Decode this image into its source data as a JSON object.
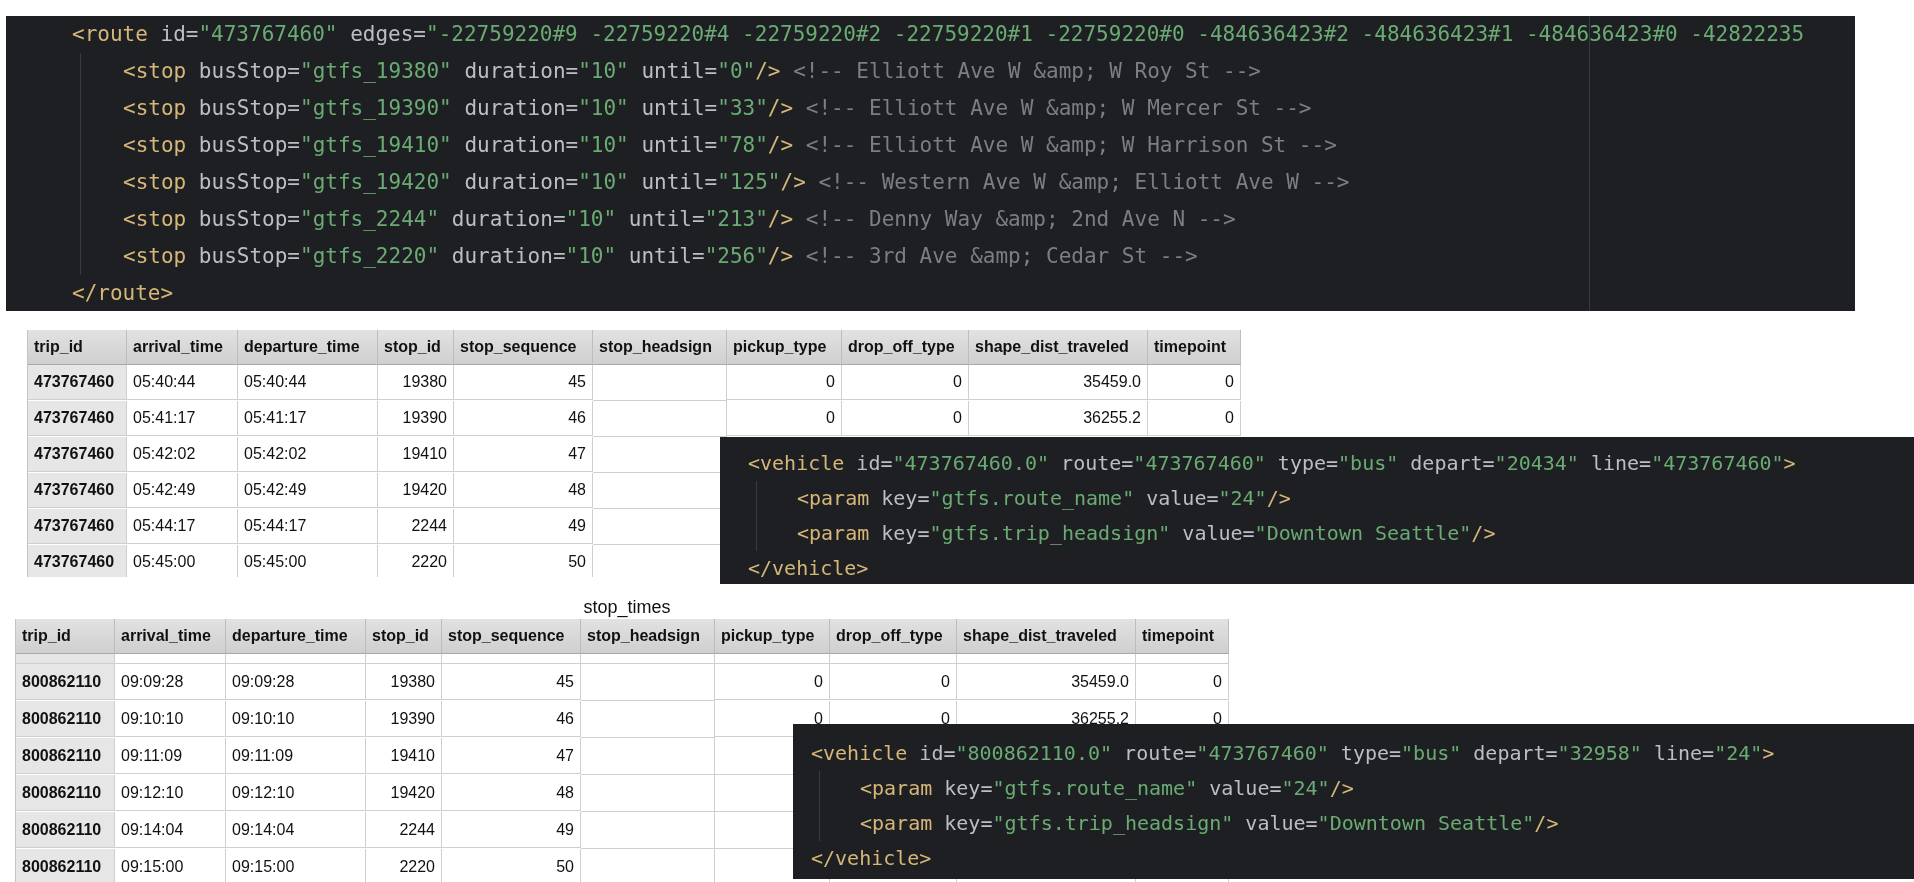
{
  "route_code": {
    "open": [
      {
        "kind": "tag",
        "text": "<route"
      },
      {
        "kind": "attr",
        "text": " id="
      },
      {
        "kind": "value",
        "text": "\"473767460\""
      },
      {
        "kind": "attr",
        "text": " edges="
      },
      {
        "kind": "value",
        "text": "\"-22759220#9 -22759220#4 -22759220#2 -22759220#1 -22759220#0 -484636423#2 -484636423#1 -484636423#0 -42822235"
      }
    ],
    "children": [
      {
        "tokens": [
          {
            "kind": "tag",
            "text": "<stop"
          },
          {
            "kind": "attr",
            "text": " busStop="
          },
          {
            "kind": "value",
            "text": "\"gtfs_19380\""
          },
          {
            "kind": "attr",
            "text": " duration="
          },
          {
            "kind": "value",
            "text": "\"10\""
          },
          {
            "kind": "attr",
            "text": " until="
          },
          {
            "kind": "value",
            "text": "\"0\""
          },
          {
            "kind": "tag",
            "text": "/>"
          },
          {
            "kind": "comment",
            "text": " <!-- Elliott Ave W &amp; W Roy St -->"
          }
        ]
      },
      {
        "tokens": [
          {
            "kind": "tag",
            "text": "<stop"
          },
          {
            "kind": "attr",
            "text": " busStop="
          },
          {
            "kind": "value",
            "text": "\"gtfs_19390\""
          },
          {
            "kind": "attr",
            "text": " duration="
          },
          {
            "kind": "value",
            "text": "\"10\""
          },
          {
            "kind": "attr",
            "text": " until="
          },
          {
            "kind": "value",
            "text": "\"33\""
          },
          {
            "kind": "tag",
            "text": "/>"
          },
          {
            "kind": "comment",
            "text": " <!-- Elliott Ave W &amp; W Mercer St -->"
          }
        ]
      },
      {
        "tokens": [
          {
            "kind": "tag",
            "text": "<stop"
          },
          {
            "kind": "attr",
            "text": " busStop="
          },
          {
            "kind": "value",
            "text": "\"gtfs_19410\""
          },
          {
            "kind": "attr",
            "text": " duration="
          },
          {
            "kind": "value",
            "text": "\"10\""
          },
          {
            "kind": "attr",
            "text": " until="
          },
          {
            "kind": "value",
            "text": "\"78\""
          },
          {
            "kind": "tag",
            "text": "/>"
          },
          {
            "kind": "comment",
            "text": " <!-- Elliott Ave W &amp; W Harrison St -->"
          }
        ]
      },
      {
        "tokens": [
          {
            "kind": "tag",
            "text": "<stop"
          },
          {
            "kind": "attr",
            "text": " busStop="
          },
          {
            "kind": "value",
            "text": "\"gtfs_19420\""
          },
          {
            "kind": "attr",
            "text": " duration="
          },
          {
            "kind": "value",
            "text": "\"10\""
          },
          {
            "kind": "attr",
            "text": " until="
          },
          {
            "kind": "value",
            "text": "\"125\""
          },
          {
            "kind": "tag",
            "text": "/>"
          },
          {
            "kind": "comment",
            "text": " <!-- Western Ave W &amp; Elliott Ave W -->"
          }
        ]
      },
      {
        "tokens": [
          {
            "kind": "tag",
            "text": "<stop"
          },
          {
            "kind": "attr",
            "text": " busStop="
          },
          {
            "kind": "value",
            "text": "\"gtfs_2244\""
          },
          {
            "kind": "attr",
            "text": " duration="
          },
          {
            "kind": "value",
            "text": "\"10\""
          },
          {
            "kind": "attr",
            "text": " until="
          },
          {
            "kind": "value",
            "text": "\"213\""
          },
          {
            "kind": "tag",
            "text": "/>"
          },
          {
            "kind": "comment",
            "text": " <!-- Denny Way &amp; 2nd Ave N -->"
          }
        ]
      },
      {
        "tokens": [
          {
            "kind": "tag",
            "text": "<stop"
          },
          {
            "kind": "attr",
            "text": " busStop="
          },
          {
            "kind": "value",
            "text": "\"gtfs_2220\""
          },
          {
            "kind": "attr",
            "text": " duration="
          },
          {
            "kind": "value",
            "text": "\"10\""
          },
          {
            "kind": "attr",
            "text": " until="
          },
          {
            "kind": "value",
            "text": "\"256\""
          },
          {
            "kind": "tag",
            "text": "/>"
          },
          {
            "kind": "comment",
            "text": " <!-- 3rd Ave &amp; Cedar St -->"
          }
        ]
      }
    ],
    "close": [
      {
        "kind": "tag",
        "text": "</route>"
      }
    ]
  },
  "stop_times_top": {
    "columns": [
      "trip_id",
      "arrival_time",
      "departure_time",
      "stop_id",
      "stop_sequence",
      "stop_headsign",
      "pickup_type",
      "drop_off_type",
      "shape_dist_traveled",
      "timepoint"
    ],
    "rows": [
      [
        "473767460",
        "05:40:44",
        "05:40:44",
        "19380",
        "45",
        null,
        "0",
        "0",
        "35459.0",
        "0"
      ],
      [
        "473767460",
        "05:41:17",
        "05:41:17",
        "19390",
        "46",
        null,
        "0",
        "0",
        "36255.2",
        "0"
      ],
      [
        "473767460",
        "05:42:02",
        "05:42:02",
        "19410",
        "47",
        null,
        null,
        null,
        null,
        null
      ],
      [
        "473767460",
        "05:42:49",
        "05:42:49",
        "19420",
        "48",
        null,
        null,
        null,
        null,
        null
      ],
      [
        "473767460",
        "05:44:17",
        "05:44:17",
        "2244",
        "49",
        null,
        null,
        null,
        null,
        null
      ],
      [
        "473767460",
        "05:45:00",
        "05:45:00",
        "2220",
        "50",
        null,
        null,
        null,
        null,
        null
      ]
    ]
  },
  "vehicle_code_top": {
    "open": [
      {
        "kind": "tag",
        "text": "<vehicle"
      },
      {
        "kind": "attr",
        "text": " id="
      },
      {
        "kind": "value",
        "text": "\"473767460.0\""
      },
      {
        "kind": "attr",
        "text": " route="
      },
      {
        "kind": "value",
        "text": "\"473767460\""
      },
      {
        "kind": "attr",
        "text": " type="
      },
      {
        "kind": "value",
        "text": "\"bus\""
      },
      {
        "kind": "attr",
        "text": " depart="
      },
      {
        "kind": "value",
        "text": "\"20434\""
      },
      {
        "kind": "attr",
        "text": " line="
      },
      {
        "kind": "value",
        "text": "\"473767460\""
      },
      {
        "kind": "tag",
        "text": ">"
      }
    ],
    "children": [
      {
        "tokens": [
          {
            "kind": "tag",
            "text": "<param"
          },
          {
            "kind": "attr",
            "text": " key="
          },
          {
            "kind": "value",
            "text": "\"gtfs.route_name\""
          },
          {
            "kind": "attr",
            "text": " value="
          },
          {
            "kind": "value",
            "text": "\"24\""
          },
          {
            "kind": "tag",
            "text": "/>"
          }
        ]
      },
      {
        "tokens": [
          {
            "kind": "tag",
            "text": "<param"
          },
          {
            "kind": "attr",
            "text": " key="
          },
          {
            "kind": "value",
            "text": "\"gtfs.trip_headsign\""
          },
          {
            "kind": "attr",
            "text": " value="
          },
          {
            "kind": "value",
            "text": "\"Downtown Seattle\""
          },
          {
            "kind": "tag",
            "text": "/>"
          }
        ]
      }
    ],
    "close": [
      {
        "kind": "tag",
        "text": "</vehicle>"
      }
    ]
  },
  "stop_times_bottom": {
    "title": "stop_times",
    "columns": [
      "trip_id",
      "arrival_time",
      "departure_time",
      "stop_id",
      "stop_sequence",
      "stop_headsign",
      "pickup_type",
      "drop_off_type",
      "shape_dist_traveled",
      "timepoint"
    ],
    "rows": [
      [
        "800862110",
        "09:09:28",
        "09:09:28",
        "19380",
        "45",
        null,
        "0",
        "0",
        "35459.0",
        "0"
      ],
      [
        "800862110",
        "09:10:10",
        "09:10:10",
        "19390",
        "46",
        null,
        "0",
        "0",
        "36255.2",
        "0"
      ],
      [
        "800862110",
        "09:11:09",
        "09:11:09",
        "19410",
        "47",
        null,
        null,
        null,
        null,
        null
      ],
      [
        "800862110",
        "09:12:10",
        "09:12:10",
        "19420",
        "48",
        null,
        null,
        null,
        null,
        null
      ],
      [
        "800862110",
        "09:14:04",
        "09:14:04",
        "2244",
        "49",
        null,
        null,
        null,
        null,
        null
      ],
      [
        "800862110",
        "09:15:00",
        "09:15:00",
        "2220",
        "50",
        null,
        null,
        null,
        null,
        null
      ]
    ]
  },
  "vehicle_code_bottom": {
    "open": [
      {
        "kind": "tag",
        "text": "<vehicle"
      },
      {
        "kind": "attr",
        "text": " id="
      },
      {
        "kind": "value",
        "text": "\"800862110.0\""
      },
      {
        "kind": "attr",
        "text": " route="
      },
      {
        "kind": "value",
        "text": "\"473767460\""
      },
      {
        "kind": "attr",
        "text": " type="
      },
      {
        "kind": "value",
        "text": "\"bus\""
      },
      {
        "kind": "attr",
        "text": " depart="
      },
      {
        "kind": "value",
        "text": "\"32958\""
      },
      {
        "kind": "attr",
        "text": " line="
      },
      {
        "kind": "value",
        "text": "\"24\""
      },
      {
        "kind": "tag",
        "text": ">"
      }
    ],
    "children": [
      {
        "tokens": [
          {
            "kind": "tag",
            "text": "<param"
          },
          {
            "kind": "attr",
            "text": " key="
          },
          {
            "kind": "value",
            "text": "\"gtfs.route_name\""
          },
          {
            "kind": "attr",
            "text": " value="
          },
          {
            "kind": "value",
            "text": "\"24\""
          },
          {
            "kind": "tag",
            "text": "/>"
          }
        ]
      },
      {
        "tokens": [
          {
            "kind": "tag",
            "text": "<param"
          },
          {
            "kind": "attr",
            "text": " key="
          },
          {
            "kind": "value",
            "text": "\"gtfs.trip_headsign\""
          },
          {
            "kind": "attr",
            "text": " value="
          },
          {
            "kind": "value",
            "text": "\"Downtown Seattle\""
          },
          {
            "kind": "tag",
            "text": "/>"
          }
        ]
      }
    ],
    "close": [
      {
        "kind": "tag",
        "text": "</vehicle>"
      }
    ]
  }
}
